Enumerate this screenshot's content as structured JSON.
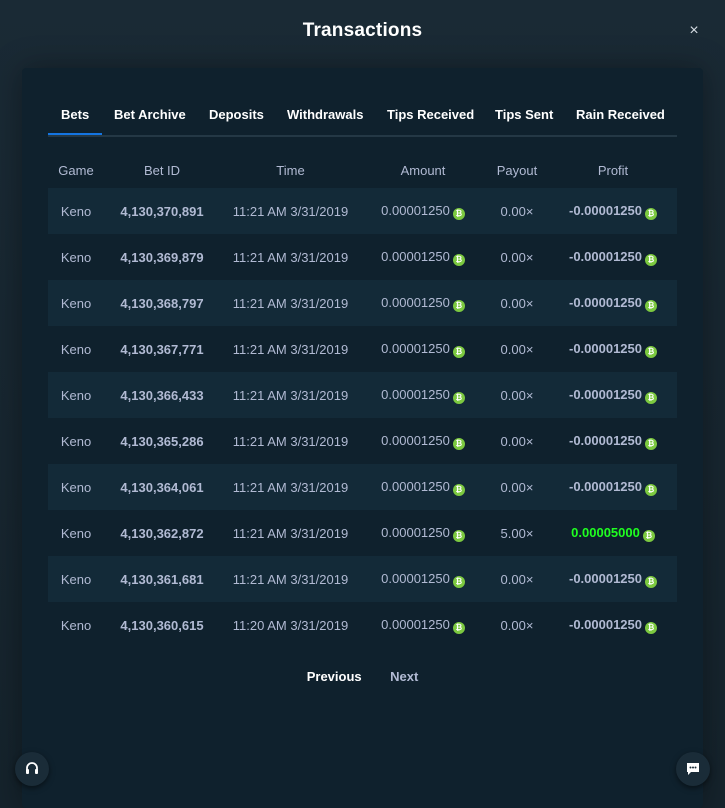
{
  "modal": {
    "title": "Transactions",
    "close_glyph": "×"
  },
  "tabs": [
    {
      "label": "Bets",
      "active": true
    },
    {
      "label": "Bet Archive",
      "active": false
    },
    {
      "label": "Deposits",
      "active": false
    },
    {
      "label": "Withdrawals",
      "active": false
    },
    {
      "label": "Tips Received",
      "active": false
    },
    {
      "label": "Tips Sent",
      "active": false
    },
    {
      "label": "Rain Received",
      "active": false
    }
  ],
  "table": {
    "headers": {
      "game": "Game",
      "bet_id": "Bet ID",
      "time": "Time",
      "amount": "Amount",
      "payout": "Payout",
      "profit": "Profit"
    },
    "currency_icon": "bitcoin-icon",
    "currency_glyph": "₿",
    "rows": [
      {
        "game": "Keno",
        "bet_id": "4,130,370,891",
        "time": "11:21 AM 3/31/2019",
        "amount": "0.00001250",
        "payout": "0.00×",
        "profit": "-0.00001250",
        "positive": false
      },
      {
        "game": "Keno",
        "bet_id": "4,130,369,879",
        "time": "11:21 AM 3/31/2019",
        "amount": "0.00001250",
        "payout": "0.00×",
        "profit": "-0.00001250",
        "positive": false
      },
      {
        "game": "Keno",
        "bet_id": "4,130,368,797",
        "time": "11:21 AM 3/31/2019",
        "amount": "0.00001250",
        "payout": "0.00×",
        "profit": "-0.00001250",
        "positive": false
      },
      {
        "game": "Keno",
        "bet_id": "4,130,367,771",
        "time": "11:21 AM 3/31/2019",
        "amount": "0.00001250",
        "payout": "0.00×",
        "profit": "-0.00001250",
        "positive": false
      },
      {
        "game": "Keno",
        "bet_id": "4,130,366,433",
        "time": "11:21 AM 3/31/2019",
        "amount": "0.00001250",
        "payout": "0.00×",
        "profit": "-0.00001250",
        "positive": false
      },
      {
        "game": "Keno",
        "bet_id": "4,130,365,286",
        "time": "11:21 AM 3/31/2019",
        "amount": "0.00001250",
        "payout": "0.00×",
        "profit": "-0.00001250",
        "positive": false
      },
      {
        "game": "Keno",
        "bet_id": "4,130,364,061",
        "time": "11:21 AM 3/31/2019",
        "amount": "0.00001250",
        "payout": "0.00×",
        "profit": "-0.00001250",
        "positive": false
      },
      {
        "game": "Keno",
        "bet_id": "4,130,362,872",
        "time": "11:21 AM 3/31/2019",
        "amount": "0.00001250",
        "payout": "5.00×",
        "profit": "0.00005000",
        "positive": true
      },
      {
        "game": "Keno",
        "bet_id": "4,130,361,681",
        "time": "11:21 AM 3/31/2019",
        "amount": "0.00001250",
        "payout": "0.00×",
        "profit": "-0.00001250",
        "positive": false
      },
      {
        "game": "Keno",
        "bet_id": "4,130,360,615",
        "time": "11:20 AM 3/31/2019",
        "amount": "0.00001250",
        "payout": "0.00×",
        "profit": "-0.00001250",
        "positive": false
      }
    ]
  },
  "pagination": {
    "previous": "Previous",
    "next": "Next"
  },
  "floating": {
    "support_icon": "headset-icon",
    "chat_icon": "chat-bubble-icon"
  },
  "colors": {
    "accent": "#1475e1",
    "positive": "#1fff20",
    "coin": "#7cc940",
    "muted": "#b1bad3"
  }
}
